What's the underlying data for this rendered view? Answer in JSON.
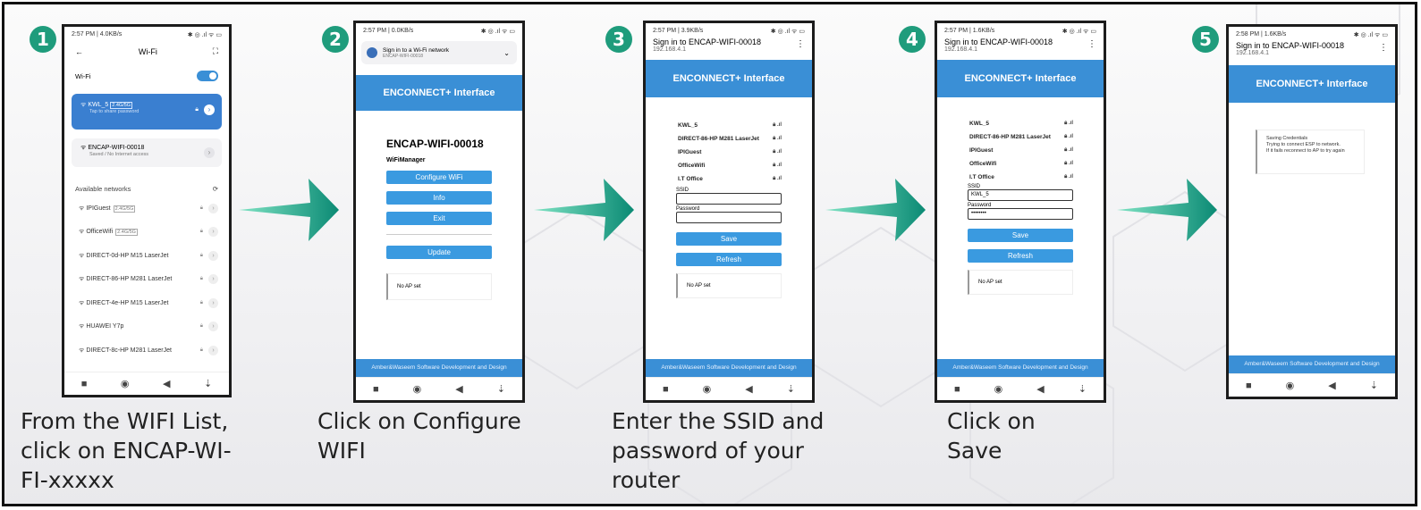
{
  "steps": [
    {
      "number": "1",
      "caption": "From the WIFI List,\nclick on ENCAP-WI-\nFI-xxxxx"
    },
    {
      "number": "2",
      "caption": "Click on Configure\nWIFI"
    },
    {
      "number": "3",
      "caption": "Enter the SSID and\npassword of your\nrouter"
    },
    {
      "number": "4",
      "caption": "Click on\nSave"
    },
    {
      "number": "5",
      "caption": ""
    }
  ],
  "phone1": {
    "status_time": "2:57 PM | 4.0KB/s",
    "status_right": "✱ ◎ .ıl ᯤ ▭",
    "title": "Wi-Fi",
    "wifi_label": "Wi-Fi",
    "connected_name": "KWL_5",
    "connected_tag": "2.4G/5G",
    "connected_sub": "Tap to share password",
    "encap_name": "ENCAP-WIFI-00018",
    "encap_sub": "Saved / No Internet access",
    "available_label": "Available networks",
    "networks": [
      {
        "name": "IPIGuest",
        "tag": "2.4G/5G"
      },
      {
        "name": "OfficeWifi",
        "tag": "2.4G/5G"
      },
      {
        "name": "DIRECT-0d-HP M15 LaserJet",
        "tag": ""
      },
      {
        "name": "DIRECT-86-HP M281 LaserJet",
        "tag": ""
      },
      {
        "name": "DIRECT-4e-HP M15 LaserJet",
        "tag": ""
      },
      {
        "name": "HUAWEI Y7p",
        "tag": ""
      },
      {
        "name": "DIRECT-8c-HP M281 LaserJet",
        "tag": ""
      }
    ]
  },
  "phone2": {
    "status_time": "2:57 PM | 0.0KB/s",
    "status_right": "✱ ◎ .ıl ᯤ ▭",
    "notif_title": "Sign in to a Wi-Fi network",
    "notif_sub": "ENCAP-WIFI-00018",
    "banner": "ENCONNECT+ Interface",
    "heading": "ENCAP-WIFI-00018",
    "sub": "WiFiManager",
    "buttons": [
      "Configure WiFi",
      "Info",
      "Exit",
      "Update"
    ],
    "box": "No AP set",
    "footer": "Amber&Waseem Software Development and Design"
  },
  "phone3": {
    "status_time": "2:57 PM | 3.9KB/s",
    "status_right": "✱ ◎ .ıl ᯤ ▭",
    "title": "Sign in to ENCAP-WIFI-00018",
    "ip": "192.168.4.1",
    "banner": "ENCONNECT+ Interface",
    "networks": [
      "KWL_5",
      "DIRECT-86-HP M281 LaserJet",
      "IPIGuest",
      "OfficeWifi",
      "I.T Office"
    ],
    "ssid_label": "SSID",
    "ssid_value": "",
    "password_label": "Password",
    "password_value": "",
    "save": "Save",
    "refresh": "Refresh",
    "box": "No AP set",
    "footer": "Amber&Waseem Software Development and Design"
  },
  "phone4": {
    "status_time": "2:57 PM | 1.6KB/s",
    "status_right": "✱ ◎ .ıl ᯤ ▭",
    "title": "Sign in to ENCAP-WIFI-00018",
    "ip": "192.168.4.1",
    "banner": "ENCONNECT+ Interface",
    "networks": [
      "KWL_5",
      "DIRECT-86-HP M281 LaserJet",
      "IPIGuest",
      "OfficeWifi",
      "I.T Office"
    ],
    "ssid_label": "SSID",
    "ssid_value": "KWL_5",
    "password_label": "Password",
    "password_value": "••••••••",
    "save": "Save",
    "refresh": "Refresh",
    "box": "No AP set",
    "footer": "Amber&Waseem Software Development and Design"
  },
  "phone5": {
    "status_time": "2:58 PM | 1.6KB/s",
    "status_right": "✱ ◎ .ıl ᯤ ▭",
    "title": "Sign in to ENCAP-WIFI-00018",
    "ip": "192.168.4.1",
    "banner": "ENCONNECT+ Interface",
    "msg1": "Saving Credentials",
    "msg2": "Trying to connect ESP to network.",
    "msg3": "If it fails reconnect to AP to try again",
    "footer": "Amber&Waseem Software Development and Design"
  },
  "colors": {
    "accent_green": "#1f9c7c",
    "ui_blue": "#3a8fd6",
    "button_blue": "#3a9ae0"
  },
  "nav_icons": [
    "square-icon",
    "circle-icon",
    "back-triangle-icon",
    "download-arrow-icon"
  ]
}
